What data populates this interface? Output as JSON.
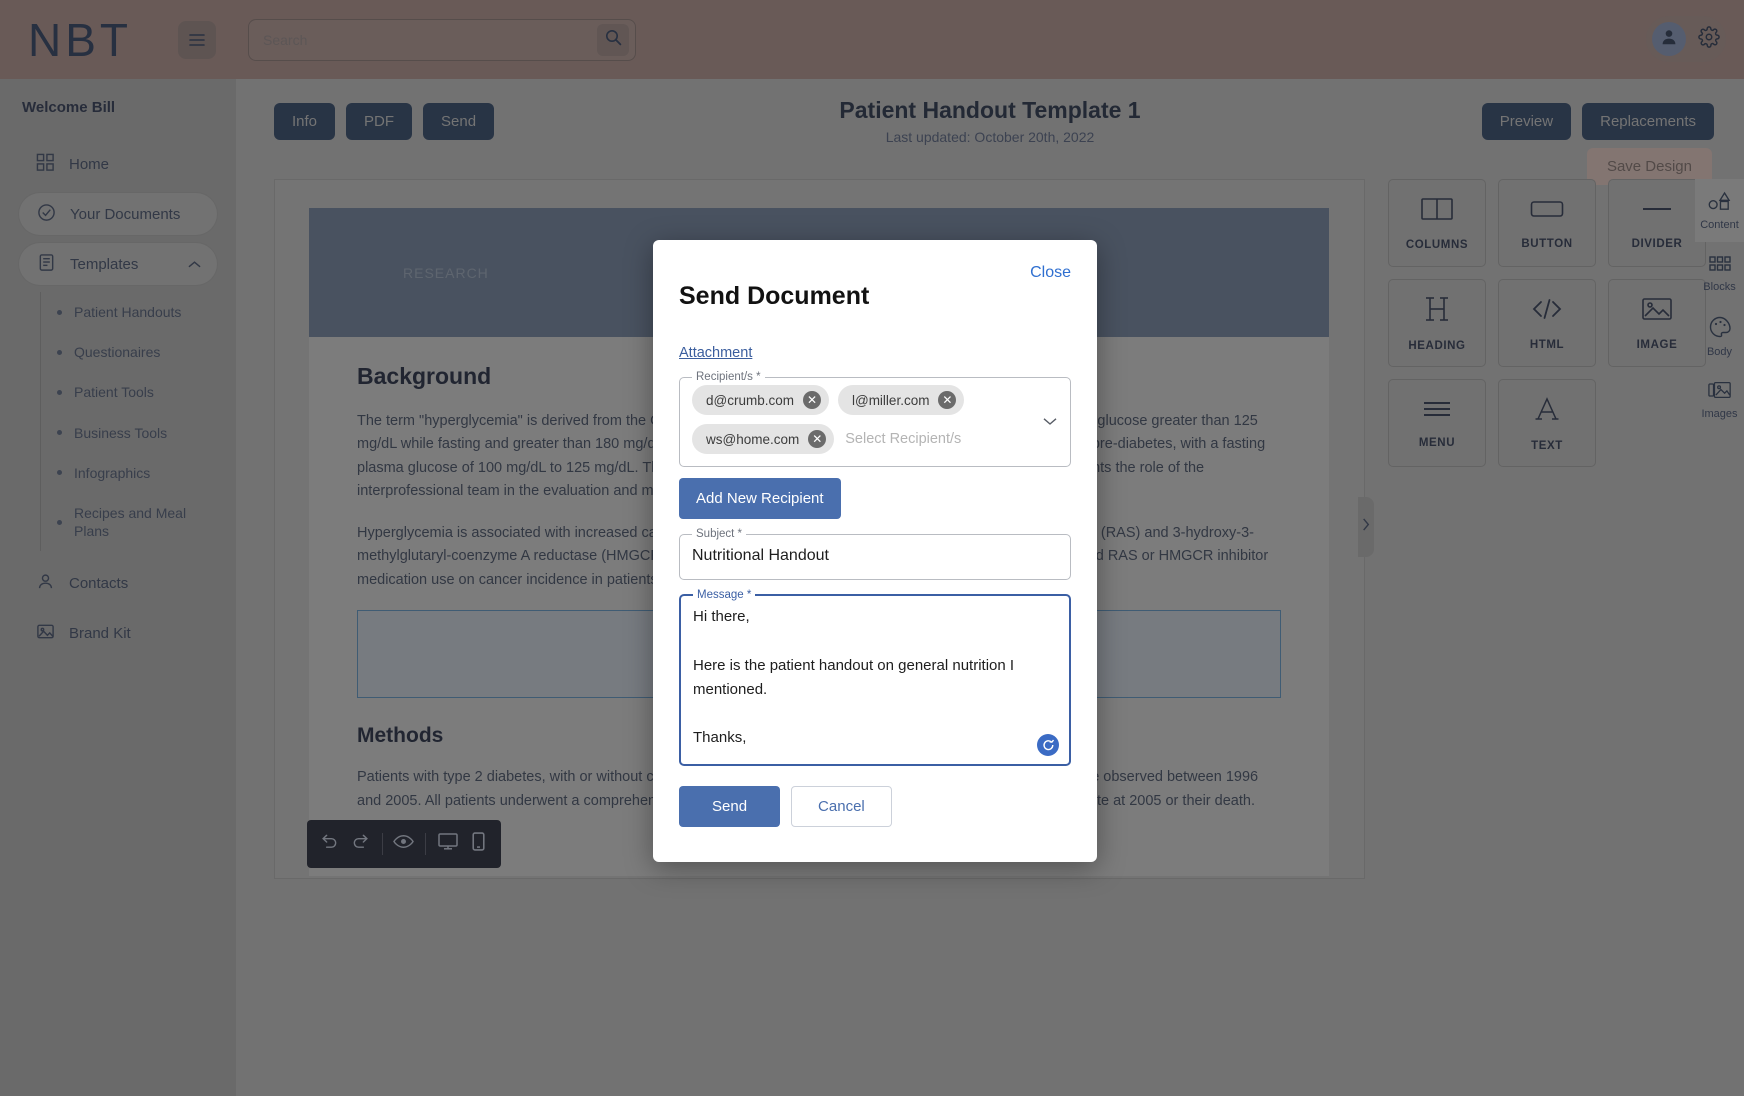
{
  "header": {
    "logo": "NBT",
    "search_placeholder": "Search",
    "search_value": "",
    "menu_icon": "hamburger-icon",
    "search_icon": "search-icon",
    "avatar_icon": "user-icon",
    "settings_icon": "gear-icon"
  },
  "sidebar": {
    "welcome": "Welcome Bill",
    "items": [
      {
        "label": "Home",
        "icon": "grid-icon"
      },
      {
        "label": "Your Documents",
        "icon": "check-circle-icon"
      },
      {
        "label": "Templates",
        "icon": "document-icon"
      },
      {
        "label": "Contacts",
        "icon": "person-icon"
      },
      {
        "label": "Brand Kit",
        "icon": "image-icon"
      }
    ],
    "templates_children": [
      "Patient Handouts",
      "Questionaires",
      "Patient Tools",
      "Business Tools",
      "Infographics",
      "Recipes and Meal Plans"
    ]
  },
  "toolbar": {
    "info_label": "Info",
    "pdf_label": "PDF",
    "send_label": "Send",
    "preview_label": "Preview",
    "replacements_label": "Replacements",
    "save_design_label": "Save Design",
    "doc_title": "Patient Handout Template 1",
    "doc_subtitle": "Last updated: October 20th, 2022"
  },
  "document": {
    "hero_label": "RESEARCH",
    "background_heading": "Background",
    "background_p1": "The term \"hyperglycemia\" is derived from the Greek hyper (high) and glykys (sweet/sugar). Hyperglycemia is blood glucose greater than 125 mg/dL while fasting and greater than 180 mg/dL 2 hours postprandial. A patient has impaired glucose tolerance, or pre-diabetes, with a fasting plasma glucose of 100 mg/dL to 125 mg/dL. This activity reviews the pathophysiology of hyperglycemia and highlights the role of the interprofessional team in the evaluation and management of this condition.",
    "background_p2": "Hyperglycemia is associated with increased cancer risk, possibly through activation of the renin-angiotensin-system (RAS) and 3-hydroxy-3-methylglutaryl-coenzyme A reductase (HMGCR). We examined the joint associations of optimal glycemic control and RAS or HMGCR inhibitor medication use on cancer incidence in patients with type 2 diabetes.",
    "methods_heading": "Methods",
    "methods_p": "Patients with type 2 diabetes, with or without cancer, and with or without RAS or HMGCR inhibitors at baseline were observed between 1996 and 2005. All patients underwent a comprehensive assessment at baseline and were followed until the censored date at 2005 or their death.",
    "image_placeholder_icon": "image-icon"
  },
  "editbar": {
    "undo_icon": "undo-icon",
    "redo_icon": "redo-icon",
    "preview_icon": "eye-icon",
    "desktop_icon": "monitor-icon",
    "mobile_icon": "phone-icon"
  },
  "palette": {
    "blocks": [
      {
        "label": "COLUMNS",
        "icon": "columns-icon"
      },
      {
        "label": "BUTTON",
        "icon": "button-icon"
      },
      {
        "label": "DIVIDER",
        "icon": "divider-icon"
      },
      {
        "label": "HEADING",
        "icon": "heading-icon"
      },
      {
        "label": "HTML",
        "icon": "code-icon"
      },
      {
        "label": "IMAGE",
        "icon": "image-icon"
      },
      {
        "label": "MENU",
        "icon": "menu-icon"
      },
      {
        "label": "TEXT",
        "icon": "text-icon"
      }
    ],
    "tabs": [
      {
        "label": "Content",
        "icon": "shapes-icon"
      },
      {
        "label": "Blocks",
        "icon": "blocks-grid-icon"
      },
      {
        "label": "Body",
        "icon": "palette-icon"
      },
      {
        "label": "Images",
        "icon": "images-icon"
      }
    ]
  },
  "modal": {
    "close_label": "Close",
    "title": "Send Document",
    "attachment_label": "Attachment",
    "recipients_legend": "Recipient/s *",
    "recipients": [
      "d@crumb.com",
      "l@miller.com",
      "ws@home.com"
    ],
    "recipients_placeholder": "Select Recipient/s",
    "add_recipient_label": "Add New Recipient",
    "subject_legend": "Subject *",
    "subject_value": "Nutritional Handout",
    "message_legend": "Message *",
    "message_value": "Hi there,\n\nHere is the patient handout on general nutrition I mentioned.\n\nThanks,\n\nChris.",
    "send_label": "Send",
    "cancel_label": "Cancel",
    "resize_icon": "resize-handle-icon"
  },
  "colors": {
    "brand_header": "#8c7672",
    "accent_blue": "#4a6fae",
    "dark_navy": "#2d3e57",
    "save_design": "#b39e98"
  }
}
